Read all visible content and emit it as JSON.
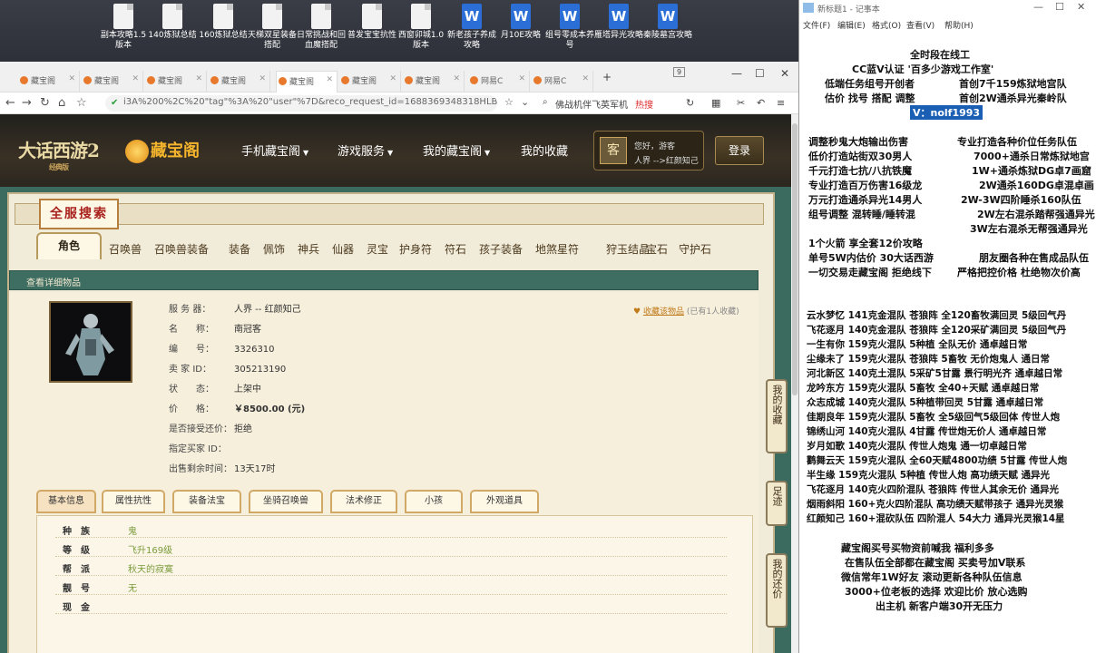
{
  "desktop_icons": [
    {
      "label": "副本攻略1.5版本",
      "type": "doc"
    },
    {
      "label": "140炼狱总结",
      "type": "doc"
    },
    {
      "label": "160炼狱总结",
      "type": "doc"
    },
    {
      "label": "天梯双星装备搭配",
      "type": "doc"
    },
    {
      "label": "日常挑战和回血魔搭配",
      "type": "doc"
    },
    {
      "label": "普发宝宝抗性",
      "type": "doc"
    },
    {
      "label": "西窗卯城1.0版本",
      "type": "doc"
    },
    {
      "label": "新老孩子养成攻略",
      "type": "word"
    },
    {
      "label": "月10E攻略",
      "type": "word"
    },
    {
      "label": "组号零成本养号",
      "type": "word"
    },
    {
      "label": "雁塔异光攻略",
      "type": "word"
    },
    {
      "label": "秦陵墓宫攻略",
      "type": "word"
    }
  ],
  "browser": {
    "tabs": [
      "藏宝阁",
      "藏宝阁",
      "藏宝阁",
      "藏宝阁",
      "藏宝阁",
      "藏宝阁",
      "藏宝阁",
      "网易C",
      "网易C"
    ],
    "tab_count": "9",
    "url": "i3A%200%2C%20\"tag\"%3A%20\"user\"%7D&reco_request_id=1688369348318HLBRJ",
    "search_text": "佛战机伴飞英军机",
    "hot_label": "热搜"
  },
  "site": {
    "game_logo": "大话西游2",
    "game_logo_sub": "经典版",
    "brand": "藏宝阁",
    "nav": [
      "手机藏宝阁",
      "游戏服务",
      "我的藏宝阁",
      "我的收藏"
    ],
    "greeting": "您好，游客",
    "realm": "人界 -->红颜知己",
    "login": "登录",
    "search_title": "全服搜索",
    "categories": [
      "角色",
      "召唤兽",
      "召唤兽装备",
      "装备",
      "佩饰",
      "神兵",
      "仙器",
      "灵宝",
      "护身符",
      "符石",
      "孩子装备",
      "地煞星符",
      "狩玉结晶",
      "宝石",
      "守护石"
    ],
    "detail_bar": "查看详细物品",
    "favorite_link": "收藏该物品",
    "favorite_count": "(已有1人收藏)",
    "item": {
      "server_k": "服 务 器：",
      "server_v": "人界 -- 红颜知己",
      "name_k": "名　　称：",
      "name_v": "南冠客",
      "id_k": "编　　号：",
      "id_v": "3326310",
      "seller_k": "卖 家 ID：",
      "seller_v": "305213190",
      "state_k": "状　　态：",
      "state_v": "上架中",
      "price_k": "价　　格：",
      "price_v": "￥8500.00 (元)",
      "bargain_k": "是否接受还价：",
      "bargain_v": "拒绝",
      "buyer_k": "指定买家 ID：",
      "buyer_v": "",
      "remain_k": "出售剩余时间：",
      "remain_v": "13天17时"
    },
    "sub_tabs": [
      "基本信息",
      "属性抗性",
      "装备法宝",
      "坐骑召唤兽",
      "法术修正",
      "小孩",
      "外观道具"
    ],
    "info_rows": [
      {
        "k": "种族",
        "v": "鬼"
      },
      {
        "k": "等级",
        "v": "飞升169级"
      },
      {
        "k": "帮派",
        "v": "秋天的寂寞"
      },
      {
        "k": "靓号",
        "v": "无"
      },
      {
        "k": "现金",
        "v": ""
      }
    ],
    "side_buttons": [
      "我的收藏",
      "足迹",
      "我的还价"
    ]
  },
  "notepad": {
    "title": "新标题1 - 记事本",
    "menu": [
      "文件(F)",
      "编辑(E)",
      "格式(O)",
      "查看(V)",
      "帮助(H)"
    ],
    "lines": [
      "全时段在线工",
      "CC蓝V认证  '百多少游戏工作室'",
      "低端任务组号开创者",
      "首创7千159炼狱地宫队",
      "估价 找号 搭配 调整",
      "首创2W通杀异光秦岭队",
      "V：nolf1993",
      "调整秒鬼大炮输出伤害",
      "专业打造各种价位任务队伍",
      "低价打造站街双30男人",
      "7000+通杀日常炼狱地宫",
      "千元打造七抗/八抗铁魔",
      "1W+通杀炼狱DG卓7画窟",
      "专业打造百万伤害16级龙",
      "2W通杀160DG卓混卓画",
      "万元打造通杀异光14男人",
      "2W-3W四阶睡杀160队伍",
      "组号调整 混转睡/睡转混",
      "2W左右混杀踏帮强通异光",
      "3W左右混杀无帮强通异光",
      "1个火箭 享全套12价攻略",
      "单号5W内估价 30大话西游",
      "朋友圈各种在售成品队伍",
      "一切交易走藏宝阁 拒绝线下",
      "严格把控价格 杜绝物次价高",
      "云水梦忆 141克金混队 苍狼阵 全120畜牧满回灵 5级回气丹",
      "飞花逐月 140克金混队 苍狼阵 全120采矿满回灵 5级回气丹",
      "一生有你 159克火混队 5种植 全队无价 通卓越日常",
      "尘缘未了 159克火混队 苍狼阵 5畜牧 无价炮鬼人 通日常",
      "河北新区 140克土混队 5采矿5甘露 景行明光齐 通卓越日常",
      "龙吟东方 159克火混队 5畜牧 全40+天赋 通卓越日常",
      "众志成城 140克火混队 5种植带回灵 5甘露 通卓越日常",
      "佳期良年 159克火混队 5畜牧 全5级回气5级回体 传世人炮",
      "锦绣山河 140克火混队 4甘露 传世炮无价人 通卓越日常",
      "岁月如歌 140克火混队 传世人炮鬼 通一切卓越日常",
      "鹳舞云天 159克火混队 全60天赋4800功绩 5甘露 传世人炮",
      "半生缘  159克火混队 5种植 传世人炮 高功绩天赋 通异光",
      "飞花逐月 140克火四阶混队 苍狼阵 传世人其余无价 通异光",
      "烟雨斜阳 160+克火四阶混队 高功绩天赋带孩子 通异光灵猴",
      "红颜知己 160+混砍队伍 四阶混人 54大力 通异光灵猴14星",
      "藏宝阁买号买物资前喊我 福利多多",
      "在售队伍全部都在藏宝阁 买卖号加V联系",
      "微信常年1W好友 滚动更新各种队伍信息",
      "3000+位老板的选择 欢迎比价 放心选购",
      "出主机 新客户端30开无压力"
    ]
  }
}
